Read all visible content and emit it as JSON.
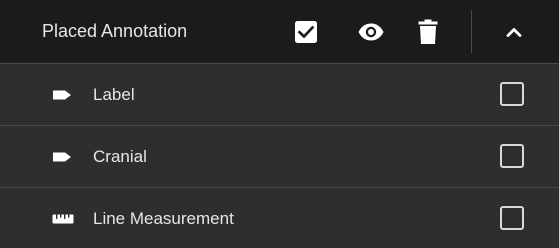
{
  "header": {
    "title": "Placed Annotation",
    "icons": [
      "checkbox-checked-icon",
      "eye-icon",
      "trash-icon",
      "chevron-up-icon"
    ]
  },
  "items": [
    {
      "label": "Label",
      "icon": "label-tag-icon",
      "checked": false
    },
    {
      "label": "Cranial",
      "icon": "label-tag-icon",
      "checked": false
    },
    {
      "label": "Line Measurement",
      "icon": "ruler-icon",
      "checked": false
    }
  ],
  "colors": {
    "header_bg": "#1b1b1b",
    "row_bg": "#2e2e2e",
    "divider": "#4a4a4a",
    "text": "#e6e6e6"
  }
}
